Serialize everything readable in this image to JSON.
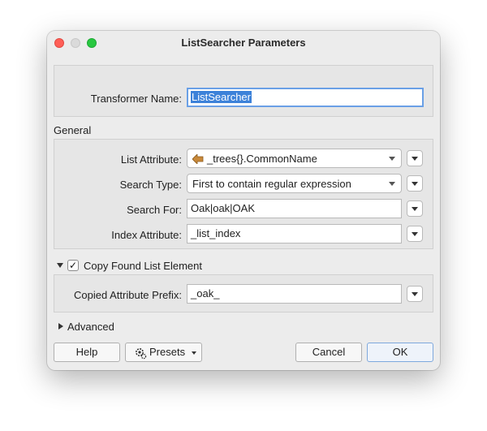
{
  "window": {
    "title": "ListSearcher Parameters"
  },
  "transformer": {
    "label": "Transformer Name:",
    "value": "ListSearcher"
  },
  "general": {
    "section_label": "General",
    "list_attribute": {
      "label": "List Attribute:",
      "value": "_trees{}.CommonName",
      "icon": "attribute-arrow-icon"
    },
    "search_type": {
      "label": "Search Type:",
      "value": "First to contain regular expression"
    },
    "search_for": {
      "label": "Search For:",
      "value": "Oak|oak|OAK"
    },
    "index_attribute": {
      "label": "Index Attribute:",
      "value": "_list_index"
    }
  },
  "copy_found": {
    "label": "Copy Found List Element",
    "checked": true,
    "check_glyph": "✓",
    "prefix": {
      "label": "Copied Attribute Prefix:",
      "value": "_oak_"
    }
  },
  "advanced": {
    "label": "Advanced"
  },
  "buttons": {
    "help": "Help",
    "presets": "Presets",
    "cancel": "Cancel",
    "ok": "OK"
  },
  "colors": {
    "window_bg": "#ececec",
    "selection": "#3d82d9",
    "focus_ring": "#6aa0e6",
    "attr_icon": "#c8893a"
  }
}
